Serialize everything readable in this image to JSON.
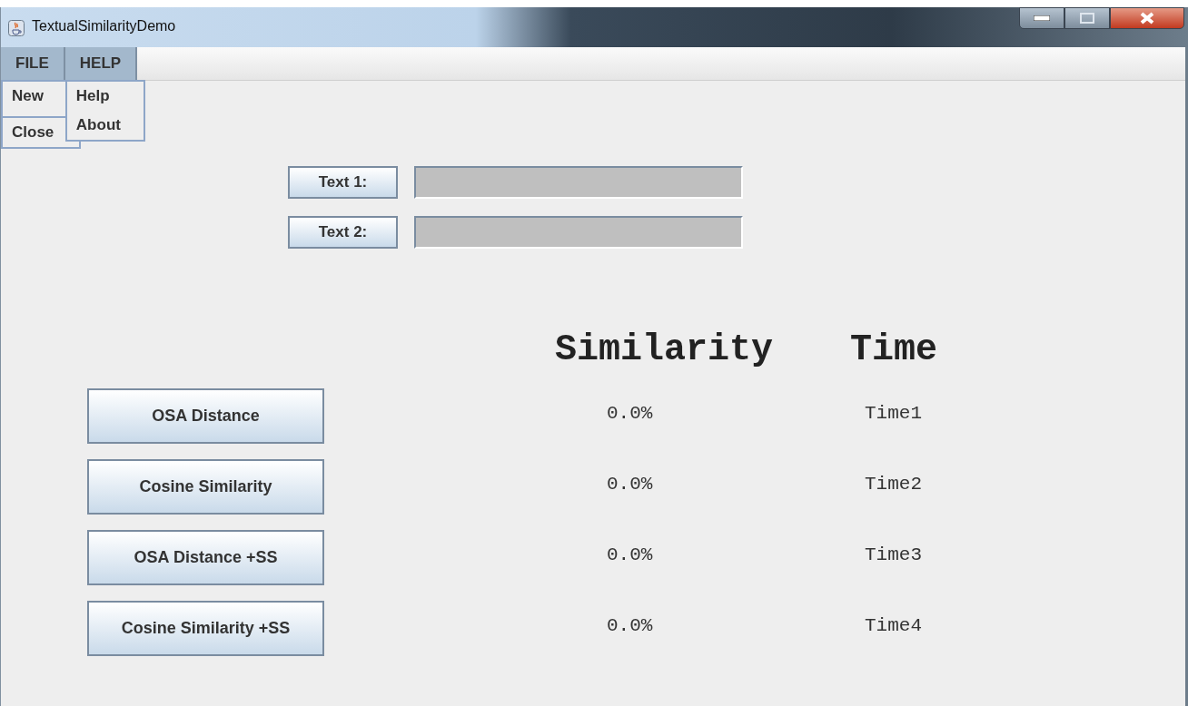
{
  "window": {
    "title": "TextualSimilarityDemo"
  },
  "menus": [
    {
      "label": "FILE",
      "selected": true,
      "open": true,
      "items": [
        {
          "label": "New"
        },
        {
          "label": "Close"
        }
      ]
    },
    {
      "label": "HELP",
      "selected": true,
      "open": true,
      "items": [
        {
          "label": "Help"
        },
        {
          "label": "About"
        }
      ]
    }
  ],
  "inputs": [
    {
      "label": "Text 1:"
    },
    {
      "label": "Text 2:"
    }
  ],
  "headers": {
    "similarity": "Similarity",
    "time": "Time"
  },
  "results": [
    {
      "button": "OSA Distance",
      "similarity": "0.0%",
      "time": "Time1"
    },
    {
      "button": "Cosine Similarity",
      "similarity": "0.0%",
      "time": "Time2"
    },
    {
      "button": "OSA Distance +SS",
      "similarity": "0.0%",
      "time": "Time3"
    },
    {
      "button": "Cosine Similarity +SS",
      "similarity": "0.0%",
      "time": "Time4"
    }
  ]
}
